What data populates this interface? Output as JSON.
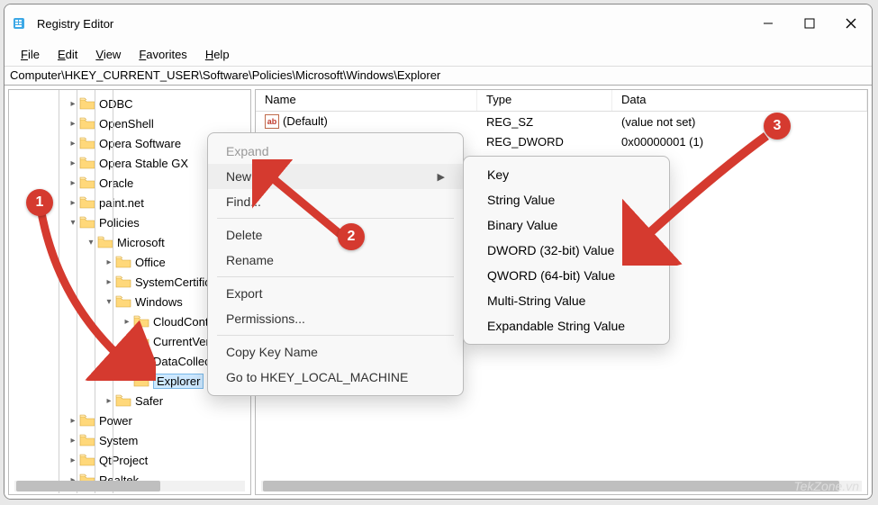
{
  "window": {
    "title": "Registry Editor"
  },
  "menubar": {
    "file": "File",
    "edit": "Edit",
    "view": "View",
    "favorites": "Favorites",
    "help": "Help",
    "file_u": "F",
    "edit_u": "E",
    "view_u": "V",
    "favorites_u": "F",
    "help_u": "H"
  },
  "address": "Computer\\HKEY_CURRENT_USER\\Software\\Policies\\Microsoft\\Windows\\Explorer",
  "tree": {
    "items": [
      {
        "ind": 64,
        "chev": ">",
        "label": "ODBC"
      },
      {
        "ind": 64,
        "chev": ">",
        "label": "OpenShell"
      },
      {
        "ind": 64,
        "chev": ">",
        "label": "Opera Software"
      },
      {
        "ind": 64,
        "chev": ">",
        "label": "Opera Stable GX"
      },
      {
        "ind": 64,
        "chev": ">",
        "label": "Oracle"
      },
      {
        "ind": 64,
        "chev": ">",
        "label": "paint.net"
      },
      {
        "ind": 64,
        "chev": "v",
        "label": "Policies"
      },
      {
        "ind": 84,
        "chev": "v",
        "label": "Microsoft"
      },
      {
        "ind": 104,
        "chev": ">",
        "label": "Office"
      },
      {
        "ind": 104,
        "chev": ">",
        "label": "SystemCertificates"
      },
      {
        "ind": 104,
        "chev": "v",
        "label": "Windows"
      },
      {
        "ind": 124,
        "chev": ">",
        "label": "CloudContent"
      },
      {
        "ind": 124,
        "chev": ">",
        "label": "CurrentVersion"
      },
      {
        "ind": 124,
        "chev": ">",
        "label": "DataCollection"
      },
      {
        "ind": 124,
        "chev": "",
        "label": "Explorer",
        "selected": true
      },
      {
        "ind": 104,
        "chev": ">",
        "label": "Safer"
      },
      {
        "ind": 64,
        "chev": ">",
        "label": "Power"
      },
      {
        "ind": 64,
        "chev": ">",
        "label": "System"
      },
      {
        "ind": 64,
        "chev": ">",
        "label": "QtProject"
      },
      {
        "ind": 64,
        "chev": ">",
        "label": "Realtek"
      }
    ]
  },
  "list": {
    "headers": {
      "name": "Name",
      "type": "Type",
      "data": "Data"
    },
    "rows": [
      {
        "name": "(Default)",
        "type": "REG_SZ",
        "data": "(value not set)",
        "icon": true
      },
      {
        "name": "",
        "type": "REG_DWORD",
        "data": "0x00000001 (1)",
        "icon": false
      }
    ],
    "col_widths": {
      "name": 246,
      "type": 150,
      "data": 180
    }
  },
  "ctx": {
    "items": [
      {
        "label": "Expand",
        "disabled": true
      },
      {
        "label": "New",
        "hover": true,
        "sub": true
      },
      {
        "label": "Find..."
      },
      {
        "sep": true
      },
      {
        "label": "Delete"
      },
      {
        "label": "Rename"
      },
      {
        "sep": true
      },
      {
        "label": "Export"
      },
      {
        "label": "Permissions..."
      },
      {
        "sep": true
      },
      {
        "label": "Copy Key Name"
      },
      {
        "label": "Go to HKEY_LOCAL_MACHINE"
      }
    ]
  },
  "submenu": {
    "items": [
      {
        "label": "Key"
      },
      {
        "sep": true
      },
      {
        "label": "String Value"
      },
      {
        "label": "Binary Value"
      },
      {
        "label": "DWORD (32-bit) Value"
      },
      {
        "label": "QWORD (64-bit) Value"
      },
      {
        "label": "Multi-String Value"
      },
      {
        "label": "Expandable String Value"
      }
    ]
  },
  "badges": {
    "b1": "1",
    "b2": "2",
    "b3": "3"
  },
  "watermark": "TekZone.vn"
}
